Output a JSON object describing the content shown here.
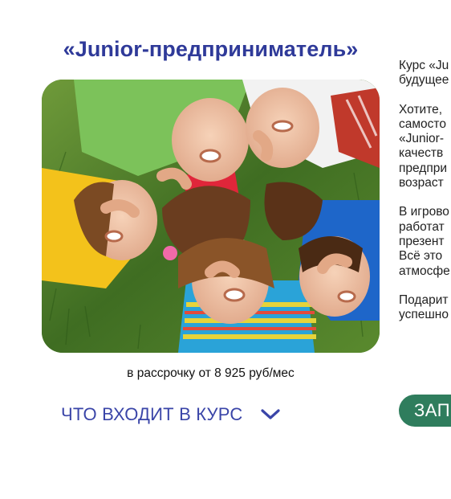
{
  "course": {
    "title": "«Junior-предприниматель»",
    "photo_alt": "Дети лежат на траве в кругу",
    "installment": "в рассрочку от 8 925 руб/мес",
    "what_included_label": "ЧТО ВХОДИТ В КУРС",
    "chevron_icon": "chevron-down-icon"
  },
  "description": {
    "paragraphs": [
      [
        "Курс «Ju",
        "будущее"
      ],
      [
        "Хотите,",
        "самосто",
        "«Junior-",
        "качеств",
        "предпри",
        "возраст"
      ],
      [
        "В игрово",
        "работат",
        "презент",
        "Всё это",
        "атмосфе"
      ],
      [
        "Подарит",
        "успешно"
      ]
    ]
  },
  "enroll": {
    "label": "ЗАП"
  },
  "colors": {
    "title": "#2f3a99",
    "link": "#3a45a8",
    "button": "#2f7d5d"
  }
}
